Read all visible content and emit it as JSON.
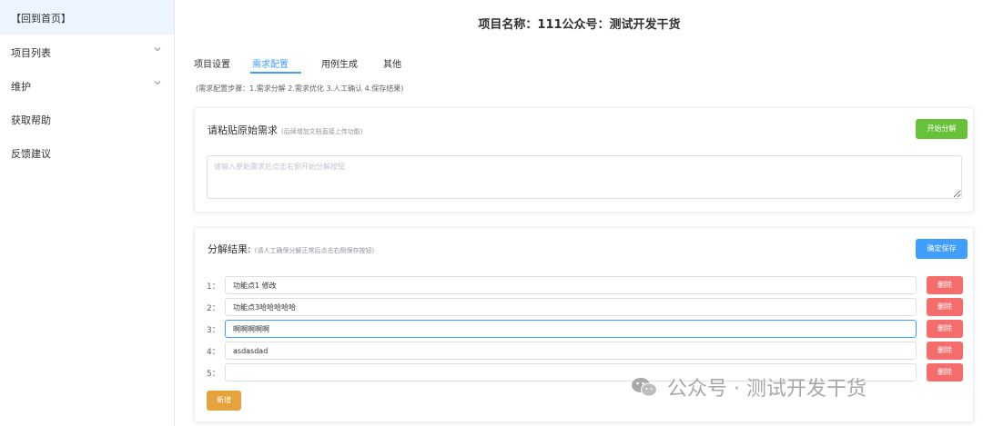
{
  "sidebar": {
    "home": "【回到首页】",
    "items": [
      {
        "label": "项目列表",
        "icon": "chevron-down-icon"
      },
      {
        "label": "维护",
        "icon": "chevron-down-icon"
      },
      {
        "label": "获取帮助"
      },
      {
        "label": "反馈建议"
      }
    ]
  },
  "header": {
    "title": "项目名称：111公众号：测试开发干货"
  },
  "tabs": [
    {
      "label": "项目设置",
      "active": false
    },
    {
      "label": "需求配置",
      "active": true
    },
    {
      "label": "用例生成",
      "active": false
    },
    {
      "label": "其他",
      "active": false
    }
  ],
  "steps": "(需求配置步骤：1.需求分解 2.需求优化 3.人工确认 4.保存结果)",
  "input_card": {
    "title": "请粘贴原始需求",
    "subtitle": "(后续增加文档直接上传功能)",
    "button": "开始分解",
    "placeholder": "请输入原始需求后点击右侧开始分解按钮"
  },
  "result_card": {
    "title": "分解结果:",
    "subtitle": "(请人工确保分解正常后点击右侧保存按钮)",
    "save_button": "确定保存",
    "delete_label": "删除",
    "add_button": "新增",
    "rows": [
      {
        "index": "1：",
        "value": "功能点1 修改"
      },
      {
        "index": "2：",
        "value": "功能点3哈哈哈哈哈"
      },
      {
        "index": "3：",
        "value": "啊啊啊啊啊"
      },
      {
        "index": "4：",
        "value": "asdasdad"
      },
      {
        "index": "5：",
        "value": ""
      }
    ]
  },
  "watermark": "公众号 · 测试开发干货",
  "colors": {
    "primary": "#409eff",
    "success": "#67c23a",
    "danger": "#f56c6c",
    "warning": "#e6a23c"
  }
}
